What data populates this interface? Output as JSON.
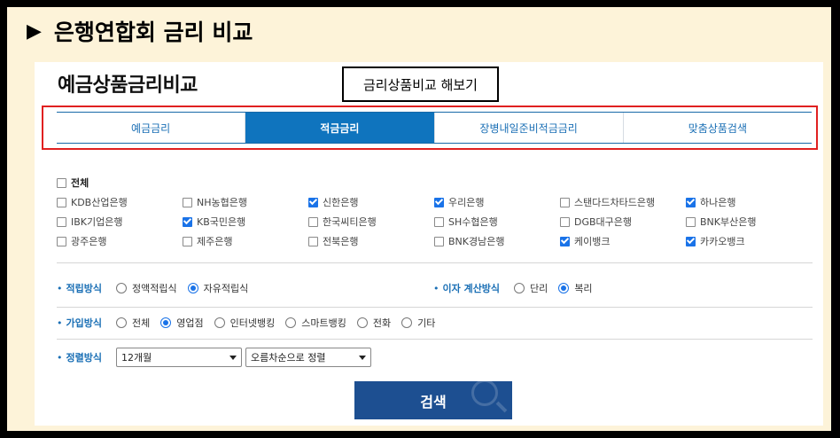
{
  "header": {
    "icon": "play-triangle-icon",
    "title": "은행연합회 금리 비교"
  },
  "panel": {
    "title": "예금상품금리비교",
    "callout": "금리상품비교 해보기"
  },
  "tabs": [
    {
      "label": "예금금리",
      "active": false
    },
    {
      "label": "적금금리",
      "active": true
    },
    {
      "label": "장병내일준비적금금리",
      "active": false
    },
    {
      "label": "맞춤상품검색",
      "active": false
    }
  ],
  "banks": {
    "all_label": "전체",
    "all_checked": false,
    "rows": [
      [
        {
          "label": "KDB산업은행",
          "checked": false
        },
        {
          "label": "NH농협은행",
          "checked": false
        },
        {
          "label": "신한은행",
          "checked": true
        },
        {
          "label": "우리은행",
          "checked": true
        },
        {
          "label": "스탠다드차타드은행",
          "checked": false
        },
        {
          "label": "하나은행",
          "checked": true
        }
      ],
      [
        {
          "label": "IBK기업은행",
          "checked": false
        },
        {
          "label": "KB국민은행",
          "checked": true
        },
        {
          "label": "한국씨티은행",
          "checked": false
        },
        {
          "label": "SH수협은행",
          "checked": false
        },
        {
          "label": "DGB대구은행",
          "checked": false
        },
        {
          "label": "BNK부산은행",
          "checked": false
        }
      ],
      [
        {
          "label": "광주은행",
          "checked": false
        },
        {
          "label": "제주은행",
          "checked": false
        },
        {
          "label": "전북은행",
          "checked": false
        },
        {
          "label": "BNK경남은행",
          "checked": false
        },
        {
          "label": "케이뱅크",
          "checked": true
        },
        {
          "label": "카카오뱅크",
          "checked": true
        }
      ]
    ]
  },
  "options": {
    "savings_method": {
      "label": "적립방식",
      "choices": [
        {
          "label": "정액적립식",
          "checked": false
        },
        {
          "label": "자유적립식",
          "checked": true
        }
      ]
    },
    "interest_calc": {
      "label": "이자 계산방식",
      "choices": [
        {
          "label": "단리",
          "checked": false
        },
        {
          "label": "복리",
          "checked": true
        }
      ]
    },
    "join_method": {
      "label": "가입방식",
      "choices": [
        {
          "label": "전체",
          "checked": false
        },
        {
          "label": "영업점",
          "checked": true
        },
        {
          "label": "인터넷뱅킹",
          "checked": false
        },
        {
          "label": "스마트뱅킹",
          "checked": false
        },
        {
          "label": "전화",
          "checked": false
        },
        {
          "label": "기타",
          "checked": false
        }
      ]
    },
    "sort_method": {
      "label": "정렬방식",
      "period_value": "12개월",
      "order_value": "오름차순으로 정렬"
    }
  },
  "search_button": {
    "label": "검색",
    "icon": "magnifier-icon"
  },
  "colors": {
    "accent": "#0f74be",
    "button": "#1d4f91",
    "highlight_border": "#e02020",
    "background": "#fdf3d9"
  }
}
